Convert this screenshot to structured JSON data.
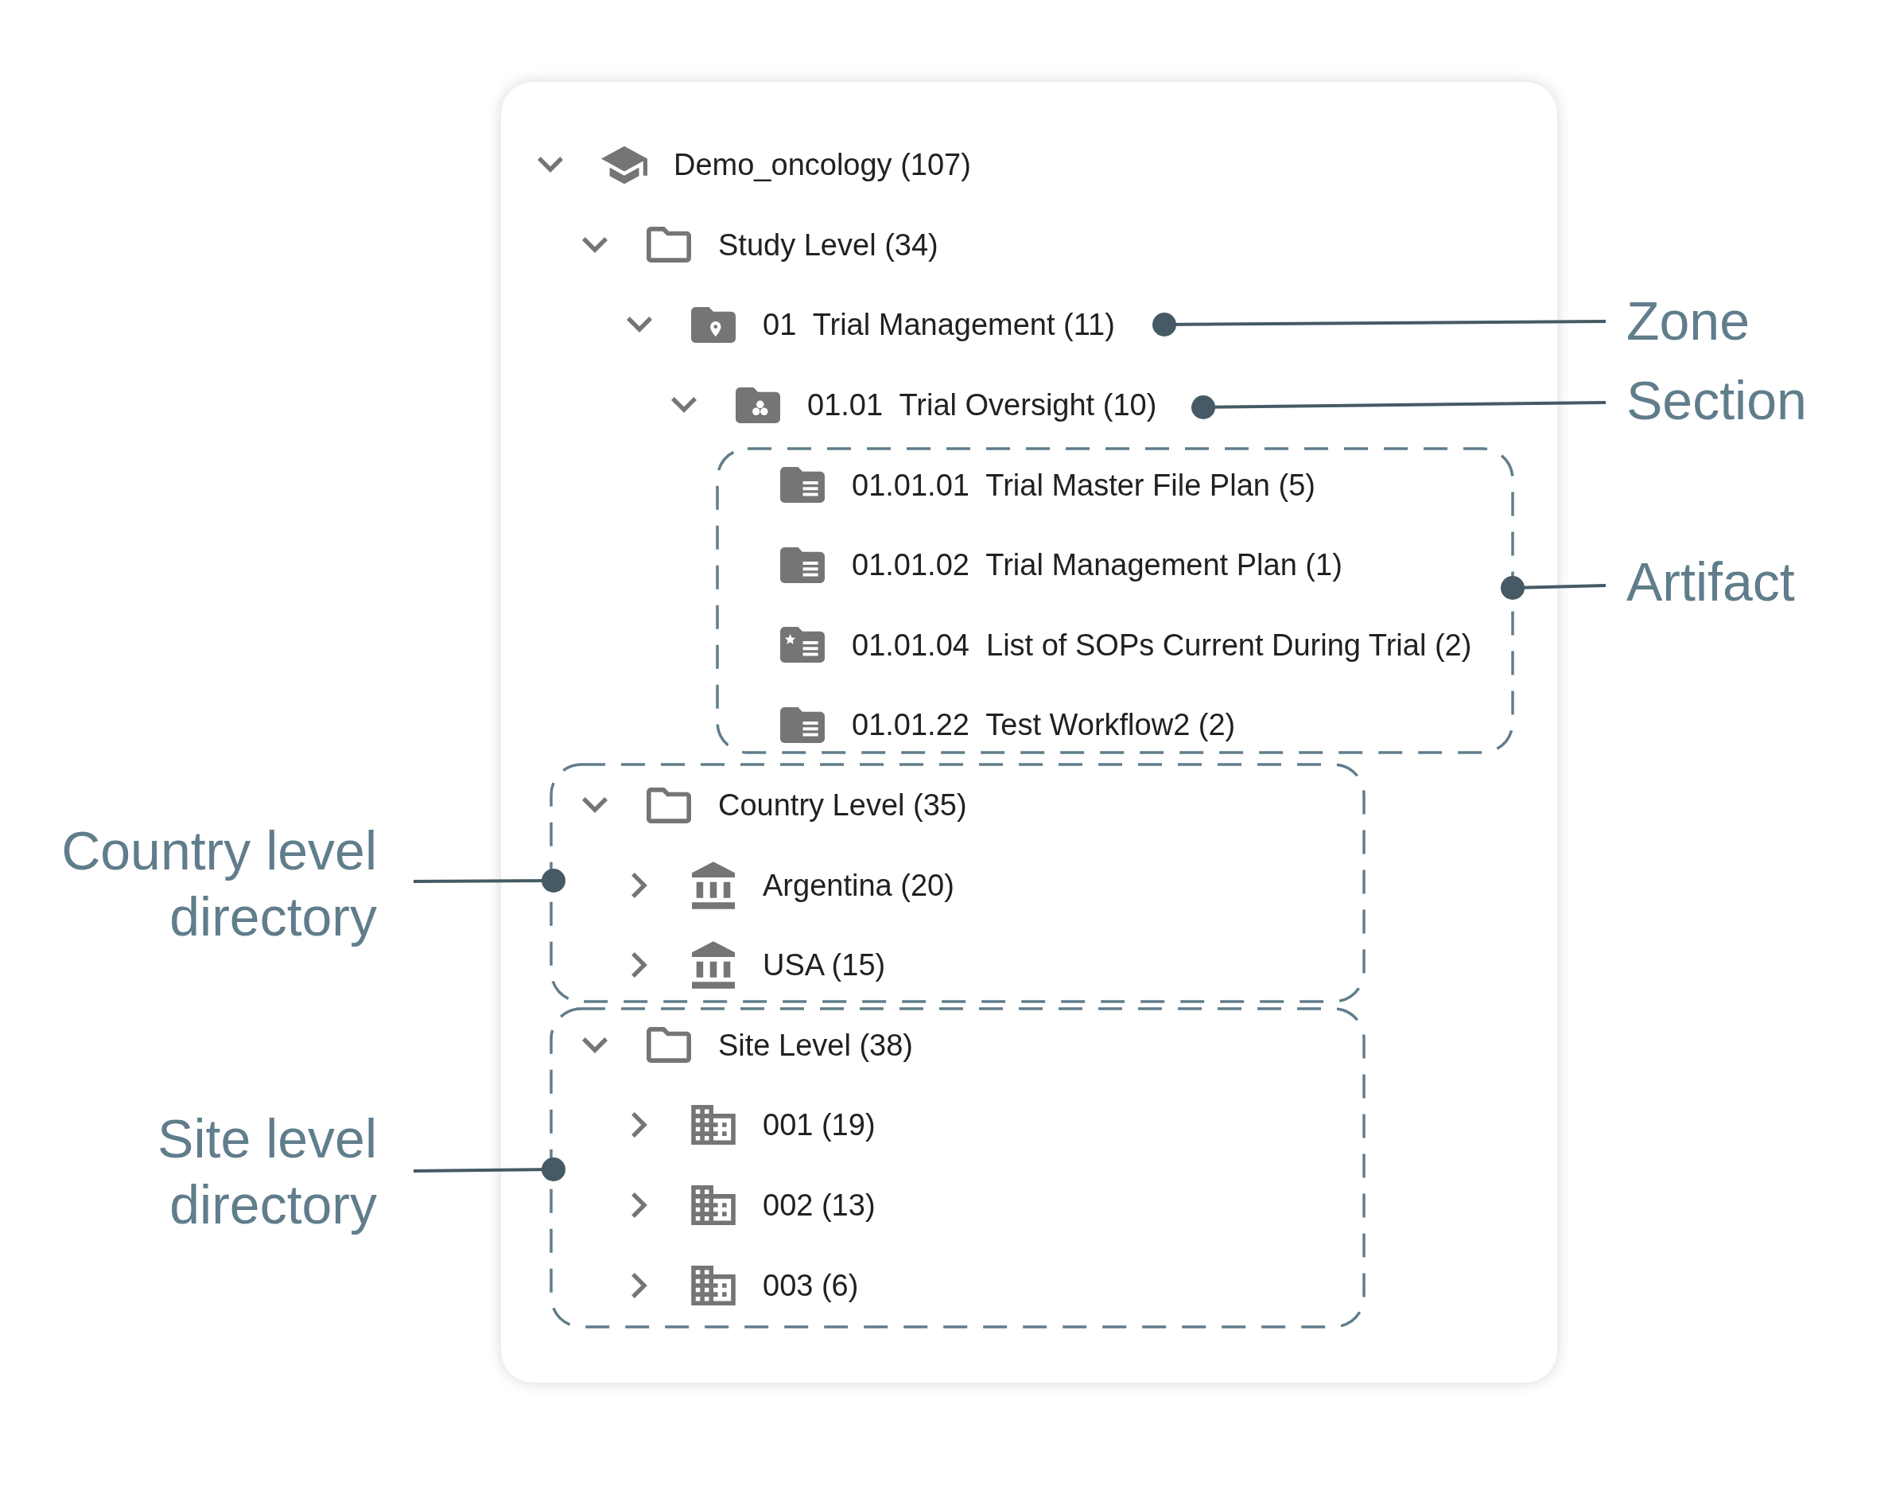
{
  "tree": {
    "label": "Demo_oncology (107)",
    "kind": "study",
    "expanded": true,
    "children": [
      {
        "label": "Study Level (34)",
        "kind": "level",
        "expanded": true,
        "children": [
          {
            "label": "01  Trial Management (11)",
            "kind": "zone",
            "expanded": true,
            "children": [
              {
                "label": "01.01  Trial Oversight (10)",
                "kind": "section",
                "expanded": true,
                "children": [
                  {
                    "label": "01.01.01  Trial Master File Plan (5)",
                    "kind": "artifact",
                    "starred": false
                  },
                  {
                    "label": "01.01.02  Trial Management Plan (1)",
                    "kind": "artifact",
                    "starred": false
                  },
                  {
                    "label": "01.01.04  List of SOPs Current During Trial (2)",
                    "kind": "artifact",
                    "starred": true
                  },
                  {
                    "label": "01.01.22  Test Workflow2 (2)",
                    "kind": "artifact",
                    "starred": false
                  }
                ]
              }
            ]
          }
        ]
      },
      {
        "label": "Country Level (35)",
        "kind": "level",
        "expanded": true,
        "children": [
          {
            "label": "Argentina (20)",
            "kind": "country",
            "expanded": false
          },
          {
            "label": "USA (15)",
            "kind": "country",
            "expanded": false
          }
        ]
      },
      {
        "label": "Site Level (38)",
        "kind": "level",
        "expanded": true,
        "children": [
          {
            "label": "001 (19)",
            "kind": "site",
            "expanded": false
          },
          {
            "label": "002 (13)",
            "kind": "site",
            "expanded": false
          },
          {
            "label": "003 (6)",
            "kind": "site",
            "expanded": false
          }
        ]
      }
    ]
  },
  "callouts": [
    {
      "label": "Zone",
      "kind": "point"
    },
    {
      "label": "Section",
      "kind": "point"
    },
    {
      "label": "Artifact",
      "kind": "group"
    },
    {
      "label": "Country level directory",
      "kind": "group"
    },
    {
      "label": "Site level directory",
      "kind": "group"
    }
  ]
}
